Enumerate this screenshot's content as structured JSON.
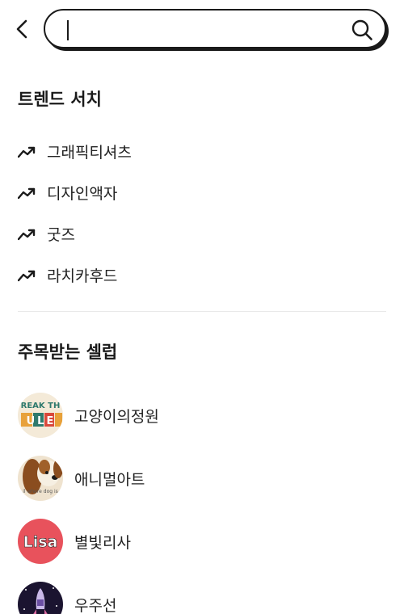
{
  "search": {
    "value": "",
    "placeholder": ""
  },
  "trending": {
    "title": "트렌드 서치",
    "items": [
      {
        "label": "그래픽티셔츠"
      },
      {
        "label": "디자인액자"
      },
      {
        "label": "굿즈"
      },
      {
        "label": "라치카후드"
      }
    ]
  },
  "celebs": {
    "title": "주목받는 셀럽",
    "items": [
      {
        "name": "고양이의정원",
        "avatar_text_top": "REAK TH",
        "avatar_text_bottom": "ULE"
      },
      {
        "name": "애니멀아트",
        "avatar_text": "il where dog is"
      },
      {
        "name": "별빛리사",
        "avatar_text": "Lisa"
      },
      {
        "name": "우주선"
      }
    ]
  },
  "icons": {
    "back": "chevron-left-icon",
    "search": "search-icon",
    "trend": "trending-up-icon"
  }
}
